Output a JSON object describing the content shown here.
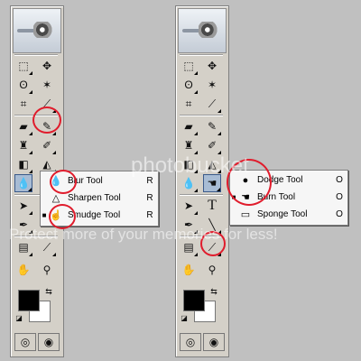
{
  "left_flyout": {
    "items": [
      {
        "label": "Blur Tool",
        "key": "R",
        "icon": "blur-icon",
        "selected": false
      },
      {
        "label": "Sharpen Tool",
        "key": "R",
        "icon": "sharpen-icon",
        "selected": false
      },
      {
        "label": "Smudge Tool",
        "key": "R",
        "icon": "smudge-icon",
        "selected": true
      }
    ]
  },
  "right_flyout": {
    "items": [
      {
        "label": "Dodge Tool",
        "key": "O",
        "icon": "dodge-icon",
        "selected": false
      },
      {
        "label": "Burn Tool",
        "key": "O",
        "icon": "burn-icon",
        "selected": true
      },
      {
        "label": "Sponge Tool",
        "key": "O",
        "icon": "sponge-icon",
        "selected": false
      }
    ]
  },
  "toolbox": {
    "type_tool_glyph": "T",
    "selected_mark": "■"
  },
  "watermark": {
    "line1": "photobucket",
    "line2": "Protect more of your memories for less!"
  },
  "colors": {
    "highlight_circle": "#e01c2c",
    "active_tool": "#a8bcd4",
    "panel_bg": "#d4d0c8",
    "foreground": "#000000",
    "background": "#ffffff"
  }
}
